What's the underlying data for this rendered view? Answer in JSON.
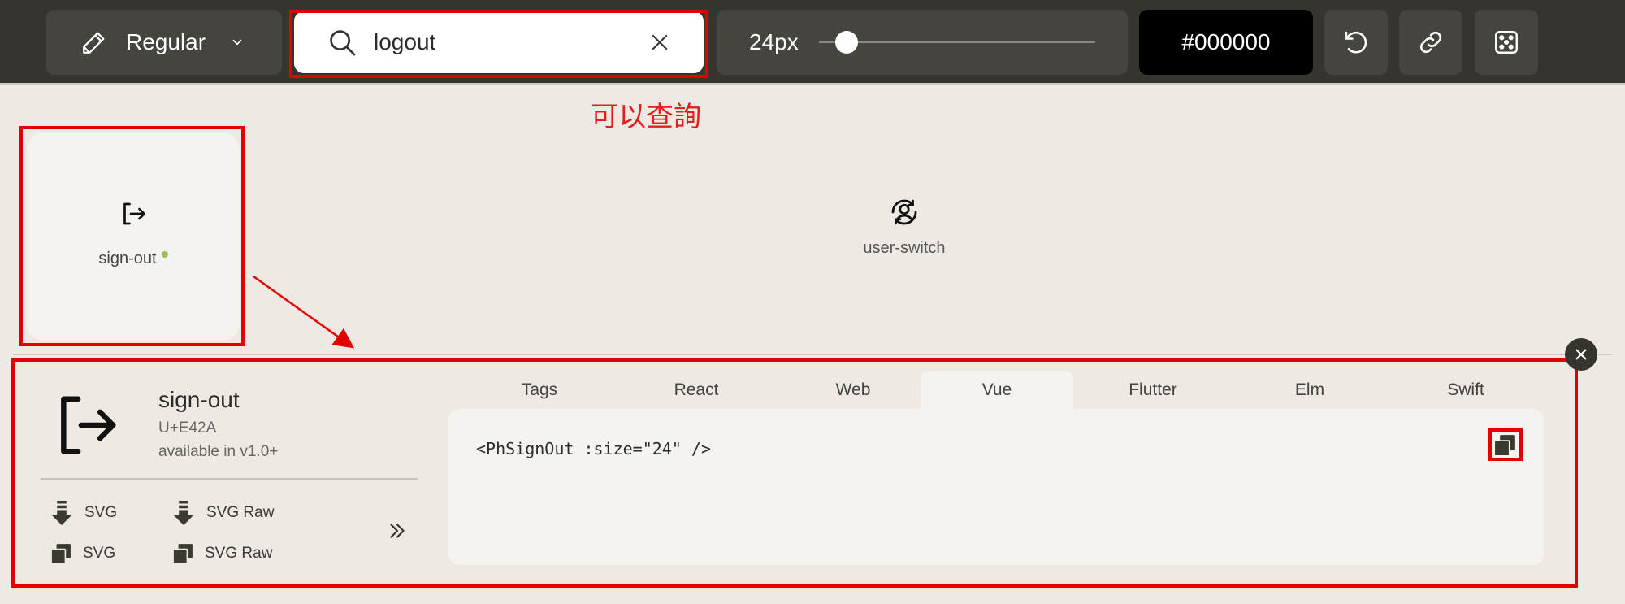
{
  "toolbar": {
    "weight_label": "Regular",
    "search": {
      "value": "logout",
      "placeholder": ""
    },
    "size_label": "24px",
    "size_slider_fraction": 0.1,
    "color_label": "#000000"
  },
  "annotation": {
    "note": "可以查詢"
  },
  "results": [
    {
      "name": "sign-out",
      "is_new": true,
      "icon": "sign-out-icon"
    },
    {
      "name": "user-switch",
      "is_new": false,
      "icon": "user-switch-icon"
    }
  ],
  "details": {
    "name": "sign-out",
    "codepoint": "U+E42A",
    "available": "available in v1.0+",
    "actions": [
      {
        "label": "SVG",
        "icon": "download-icon"
      },
      {
        "label": "SVG Raw",
        "icon": "download-icon"
      },
      {
        "label": "SVG",
        "icon": "copy-icon"
      },
      {
        "label": "SVG Raw",
        "icon": "copy-icon"
      }
    ],
    "tabs": [
      "Tags",
      "React",
      "Web",
      "Vue",
      "Flutter",
      "Elm",
      "Swift"
    ],
    "active_tab": "Vue",
    "snippet": "<PhSignOut :size=\"24\" />"
  },
  "colors": {
    "toolbar_bg": "#35342f",
    "accent_red": "#e30000",
    "page_bg": "#eeeae3",
    "new_dot": "#9bbf5a"
  }
}
